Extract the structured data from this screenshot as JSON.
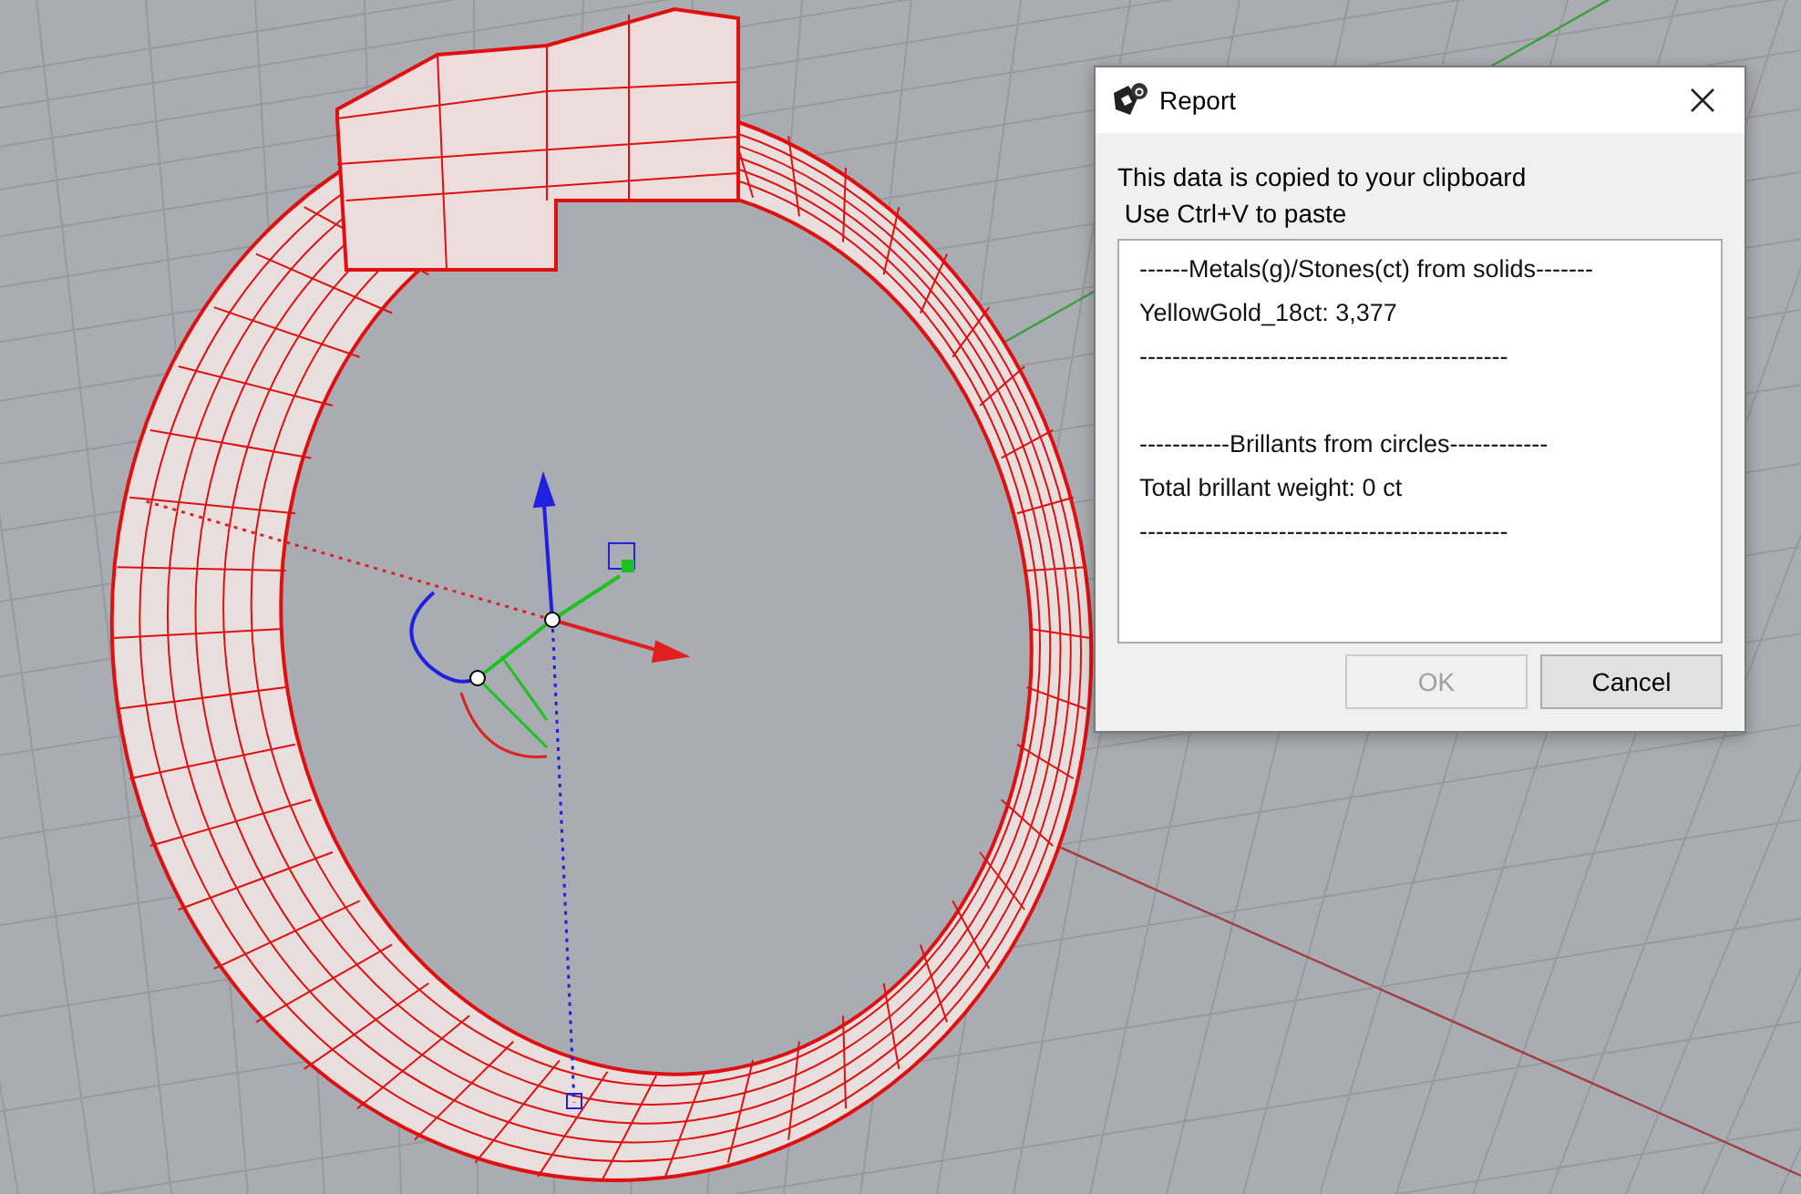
{
  "dialog": {
    "title": "Report",
    "message": [
      "This data is copied to your clipboard",
      " Use Ctrl+V to paste"
    ],
    "report_sections": [
      {
        "lines": [
          "------Metals(g)/Stones(ct) from solids-------",
          "YellowGold_18ct: 3,377",
          "---------------------------------------------"
        ]
      },
      {
        "lines": [
          "-----------Brillants from circles------------",
          "Total brillant weight: 0 ct",
          "---------------------------------------------"
        ]
      }
    ],
    "buttons": [
      {
        "label": "OK",
        "disabled": true
      },
      {
        "label": "Cancel",
        "disabled": false
      }
    ]
  }
}
